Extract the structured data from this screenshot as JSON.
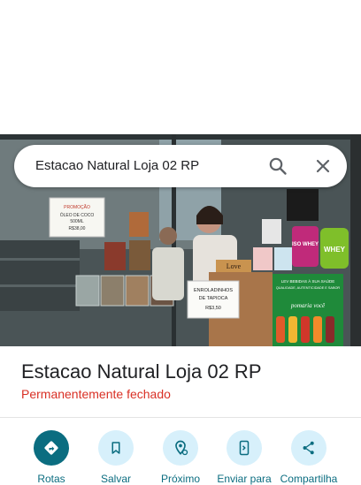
{
  "search": {
    "query": "Estacao Natural Loja 02 RP"
  },
  "photo_signs": {
    "promo": [
      "PROMOÇÃO",
      "ÓLEO DE COCO",
      "500ML",
      "R$38,00"
    ],
    "enroladinhos": [
      "ENROLADINHOS",
      "DE TAPIOCA",
      "R$3,50"
    ],
    "love": "Love",
    "whey": "WHEY",
    "iso_whey": "ISO WHEY",
    "ad_lines": [
      "LEV BEBIDAS À SUA SAÚDE",
      "QUALIDADE, AUTENTICIDADE E SABOR"
    ],
    "ad_tag": "pomaria você"
  },
  "place": {
    "name": "Estacao Natural Loja 02 RP",
    "status": "Permanentemente fechado"
  },
  "actions": [
    {
      "label": "Rotas",
      "icon": "directions-icon"
    },
    {
      "label": "Salvar",
      "icon": "bookmark-icon"
    },
    {
      "label": "Próximo",
      "icon": "nearby-icon"
    },
    {
      "label": "Enviar para",
      "icon": "send-to-phone-icon"
    },
    {
      "label": "Compartilha",
      "icon": "share-icon"
    }
  ],
  "colors": {
    "accent": "#0b6d80",
    "action_bg": "#d7f0fb",
    "closed": "#d93025"
  }
}
